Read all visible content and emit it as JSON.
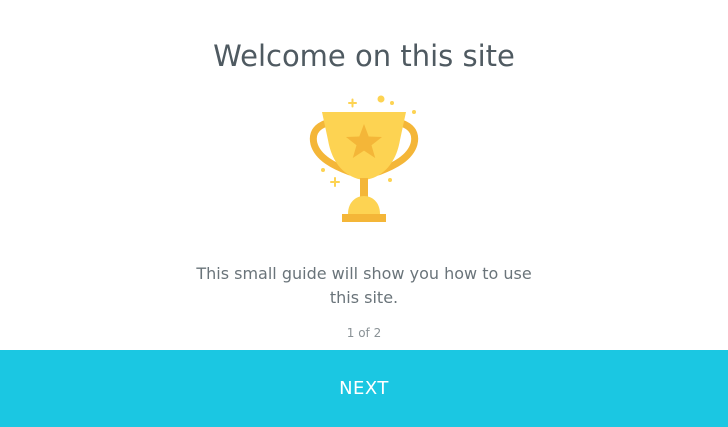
{
  "dialog": {
    "title": "Welcome on this site",
    "description": "This small guide will show you how to use this site.",
    "pager": "1 of 2",
    "next_label": "NEXT",
    "illustration": "trophy-icon"
  },
  "colors": {
    "title": "#4f5a61",
    "text": "#6a747a",
    "muted": "#8a9296",
    "accent": "#1bc7e2",
    "trophy_gold": "#fdd352",
    "trophy_shade": "#f4b638"
  }
}
